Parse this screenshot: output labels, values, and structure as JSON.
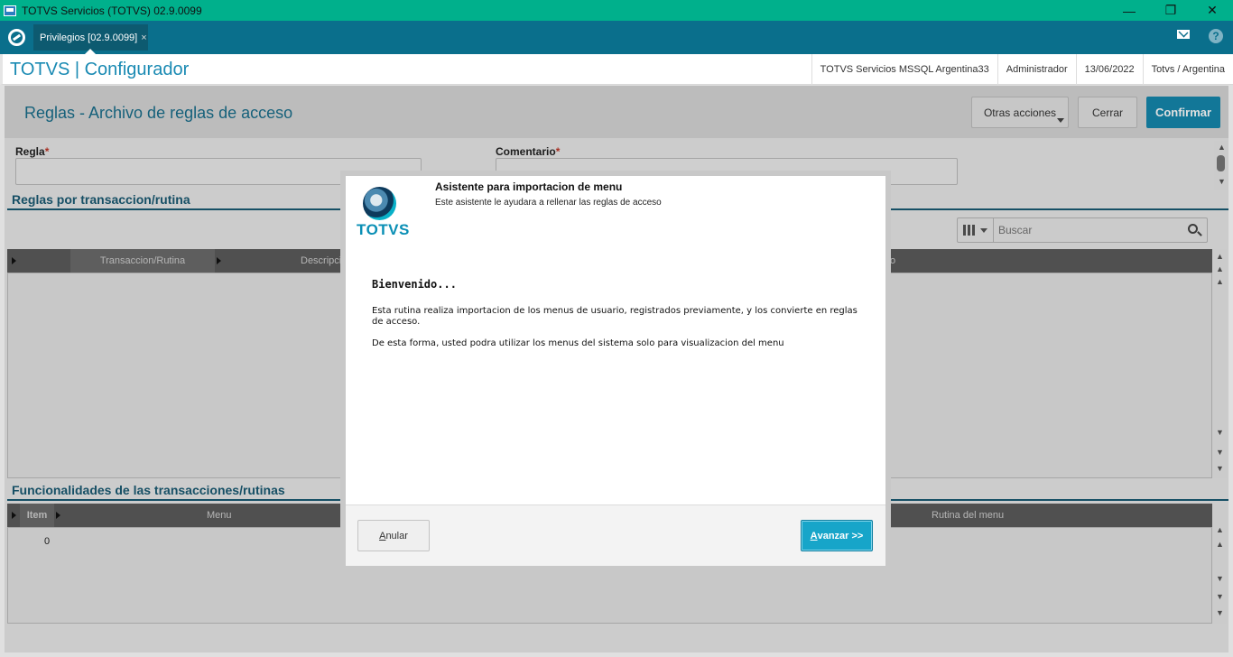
{
  "window": {
    "title": "TOTVS Servicios (TOTVS) 02.9.0099",
    "controls": {
      "minimize": "—",
      "restore": "❐",
      "close": "✕"
    }
  },
  "tabbar": {
    "tab_label": "Privilegios [02.9.0099]",
    "tab_close": "×"
  },
  "header": {
    "brand": "TOTVS | Configurador",
    "environment": "TOTVS Servicios MSSQL Argentina33",
    "user": "Administrador",
    "date": "13/06/2022",
    "company": "Totvs / Argentina"
  },
  "page": {
    "title": "Reglas - Archivo de reglas de acceso",
    "actions": {
      "other": "Otras acciones",
      "close": "Cerrar",
      "confirm": "Confirmar"
    }
  },
  "form": {
    "rule_label": "Regla",
    "comment_label": "Comentario",
    "required_mark": "*"
  },
  "section1": {
    "title": "Reglas por transaccion/rutina",
    "search_placeholder": "Buscar",
    "columns": [
      "Transaccion/Rutina",
      "Descripcion",
      "o"
    ]
  },
  "section2": {
    "title": "Funcionalidades de las transacciones/rutinas",
    "columns": [
      "Item",
      "Menu",
      "Rutina del menu"
    ],
    "rows": [
      {
        "item": "0"
      }
    ]
  },
  "dialog": {
    "title": "Asistente para importacion de menu",
    "subtitle": "Este asistente le ayudara a rellenar las reglas de acceso",
    "logo_text": "TOTVS",
    "welcome": "Bienvenido...",
    "paragraph1": "Esta rutina realiza importacion de los menus de usuario, registrados previamente, y los convierte en reglas de acceso.",
    "paragraph2": "De esta forma, usted podra utilizar los menus del sistema solo para visualizacion del menu",
    "cancel_hotkey": "A",
    "cancel_rest": "nular",
    "next_hotkey": "A",
    "next_rest": "vanzar >>"
  },
  "colors": {
    "titlebar": "#00b08c",
    "tabbar": "#0a6f8c",
    "accent": "#1588ad",
    "brand": "#1a8ab3"
  }
}
